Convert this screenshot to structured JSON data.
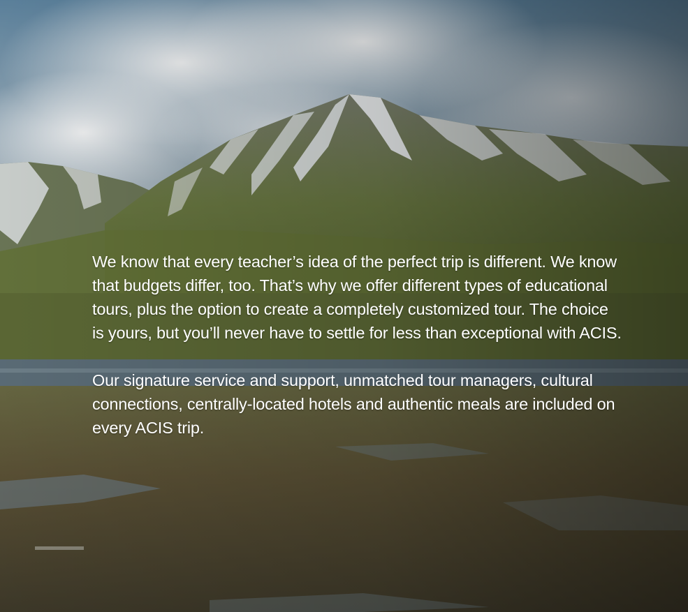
{
  "hero": {
    "background_image": "mountain-landscape",
    "paragraph_1": "We know that every teacher’s idea of the perfect trip is different. We know that budgets differ, too. That’s why we offer different types of educational tours, plus the option to create a completely customized tour. The choice is yours, but you’ll never have to settle for less than exceptional with ACIS.",
    "paragraph_2": "Our signature service and support, unmatched tour managers, cultural connections, centrally-located hotels and authentic meals are included on every ACIS trip."
  },
  "colors": {
    "text": "#ffffff",
    "sky": "#6f8ea4",
    "snow": "#e9edf0",
    "grass": "#6f7a3a",
    "water": "#5d6f7c",
    "ground": "#5a4e36"
  }
}
